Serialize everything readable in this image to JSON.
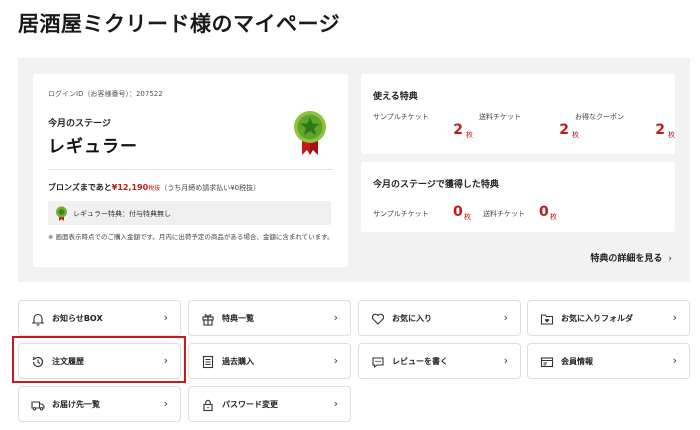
{
  "page": {
    "title": "居酒屋ミクリード様のマイページ"
  },
  "status_card": {
    "login_id": "ログインID（お客様番号）：207522",
    "stage_label": "今月のステージ",
    "stage_name": "レギュラー",
    "bronze_prefix": "ブロンズまであと",
    "bronze_amount": "¥12,190",
    "bronze_tax": "税抜",
    "bronze_note": "（うち月締め請求払い¥0税抜）",
    "benefit_text": "レギュラー特典：付与特典無し",
    "notice": "※ 画面表示時点でのご購入金額です。月内に出荷予定の商品がある場合、金額に含まれています。"
  },
  "available_benefits": {
    "title": "使える特典",
    "items": [
      {
        "label": "サンプルチケット",
        "count": "2",
        "unit": "枚"
      },
      {
        "label": "送料チケット",
        "count": "2",
        "unit": "枚"
      },
      {
        "label": "お得なクーポン",
        "count": "2",
        "unit": "枚"
      }
    ]
  },
  "earned_benefits": {
    "title": "今月のステージで獲得した特典",
    "items": [
      {
        "label": "サンプルチケット",
        "count": "0",
        "unit": "枚"
      },
      {
        "label": "送料チケット",
        "count": "0",
        "unit": "枚"
      }
    ]
  },
  "detail_link": {
    "label": "特典の詳細を見る",
    "chevron": "›"
  },
  "menu": {
    "chevron": "›",
    "items": [
      {
        "label": "お知らせBOX",
        "icon": "bell-icon"
      },
      {
        "label": "特典一覧",
        "icon": "gift-icon"
      },
      {
        "label": "お気に入り",
        "icon": "heart-icon"
      },
      {
        "label": "お気に入りフォルダ",
        "icon": "folder-icon"
      },
      {
        "label": "注文履歴",
        "icon": "history-icon"
      },
      {
        "label": "過去購入",
        "icon": "list-icon"
      },
      {
        "label": "レビューを書く",
        "icon": "chat-icon"
      },
      {
        "label": "会員情報",
        "icon": "id-card-icon"
      },
      {
        "label": "お届け先一覧",
        "icon": "truck-icon"
      },
      {
        "label": "パスワード変更",
        "icon": "lock-icon"
      }
    ]
  },
  "colors": {
    "accent": "#c0181b",
    "panel_bg": "#f2f2f2",
    "highlight": "#c81a1e"
  }
}
